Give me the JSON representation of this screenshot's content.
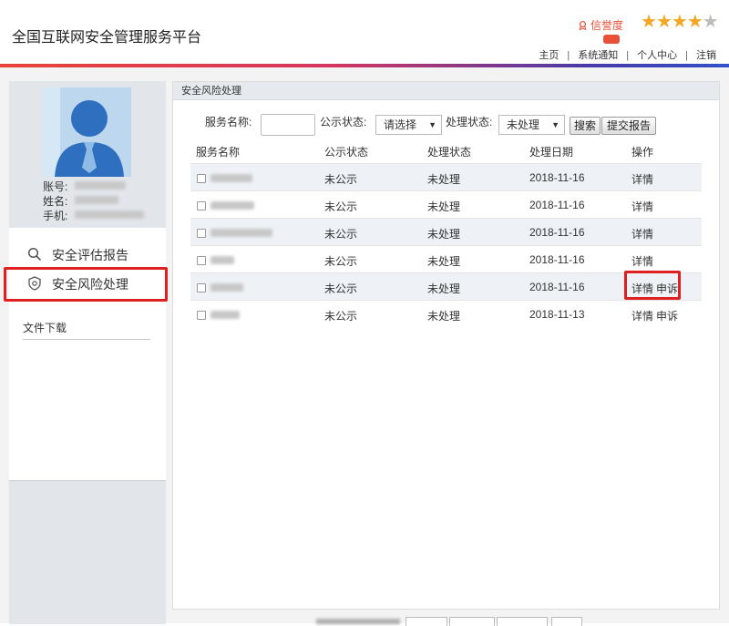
{
  "header": {
    "title": "全国互联网安全管理服务平台",
    "credit_label": "信誉度",
    "rating": {
      "value": 4,
      "max": 5
    },
    "nav": [
      "主页",
      "系统通知",
      "个人中心",
      "注销"
    ]
  },
  "sidebar": {
    "profile_labels": {
      "account": "账号:",
      "name": "姓名:",
      "phone": "手机:"
    },
    "menu": [
      {
        "label": "安全评估报告",
        "icon": "search-icon"
      },
      {
        "label": "安全风险处理",
        "icon": "shield-icon",
        "active": true
      }
    ],
    "downloads_label": "文件下载"
  },
  "panel": {
    "title": "安全风险处理",
    "filters": {
      "service_name_label": "服务名称:",
      "publish_status_label": "公示状态:",
      "publish_status_value": "请选择",
      "process_status_label": "处理状态:",
      "process_status_value": "未处理",
      "search_button": "搜索",
      "submit_button": "提交报告"
    },
    "columns": [
      "服务名称",
      "公示状态",
      "处理状态",
      "处理日期",
      "操作"
    ],
    "rows": [
      {
        "publish": "未公示",
        "status": "未处理",
        "date": "2018-11-16",
        "actions": [
          "详情"
        ]
      },
      {
        "publish": "未公示",
        "status": "未处理",
        "date": "2018-11-16",
        "actions": [
          "详情"
        ]
      },
      {
        "publish": "未公示",
        "status": "未处理",
        "date": "2018-11-16",
        "actions": [
          "详情"
        ]
      },
      {
        "publish": "未公示",
        "status": "未处理",
        "date": "2018-11-16",
        "actions": [
          "详情"
        ]
      },
      {
        "publish": "未公示",
        "status": "未处理",
        "date": "2018-11-16",
        "actions": [
          "详情",
          "申诉"
        ]
      },
      {
        "publish": "未公示",
        "status": "未处理",
        "date": "2018-11-13",
        "actions": [
          "详情",
          "申诉"
        ]
      }
    ]
  },
  "colors": {
    "accent_red": "#e02020",
    "star_on": "#f5a623",
    "star_off": "#bdbdbd",
    "panel_header": "#e6eaef"
  }
}
